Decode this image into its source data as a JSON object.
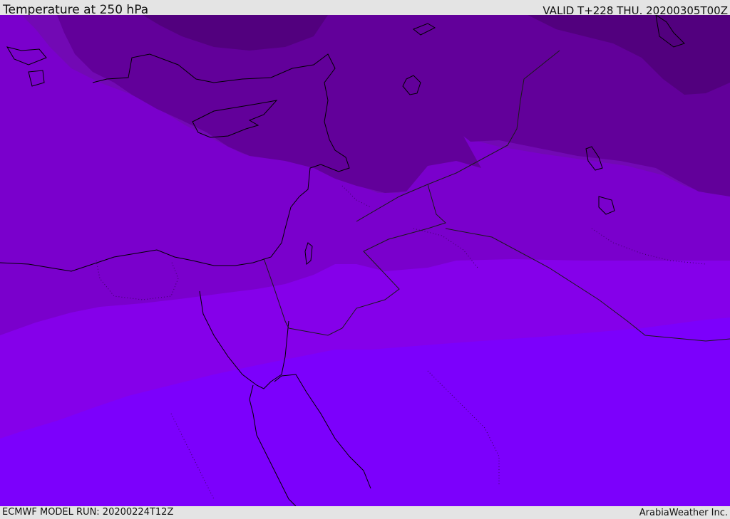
{
  "header": {
    "title": "Temperature at 250 hPa",
    "valid_time": "VALID T+228 THU. 20200305T00Z"
  },
  "footer": {
    "model_run": "ECMWF MODEL RUN: 20200224T12Z",
    "credit": "ArabiaWeather Inc."
  },
  "map": {
    "colors": {
      "band_darkest": "#52007e",
      "band_dark": "#62009a",
      "band_mid": "#7209b4",
      "band_lower_mid": "#7a00cc",
      "band_violet": "#8500ea",
      "band_brightest": "#7c00fc",
      "coastline": "#000000",
      "border": "#1a1a1a"
    }
  }
}
